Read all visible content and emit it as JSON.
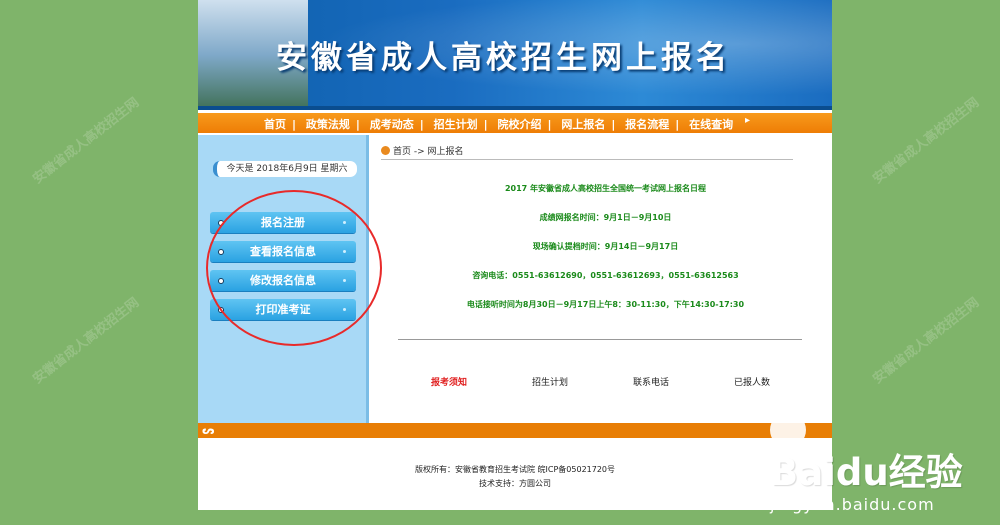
{
  "banner": {
    "title": "安徽省成人高校招生网上报名"
  },
  "nav": {
    "items": [
      "首页",
      "政策法规",
      "成考动态",
      "招生计划",
      "院校介绍",
      "网上报名",
      "报名流程",
      "在线查询"
    ],
    "end_mark": "▸"
  },
  "sidebar": {
    "date_label": "今天是 2018年6月9日 星期六",
    "buttons": [
      "报名注册",
      "查看报名信息",
      "修改报名信息",
      "打印准考证"
    ]
  },
  "breadcrumb": {
    "home": "首页",
    "arrow": " -> ",
    "current": "网上报名"
  },
  "notice": {
    "title": "2017 年安徽省成人高校招生全国统一考试网上报名日程",
    "lines": [
      "成绩网报名时间：9月1日－9月10日",
      "现场确认提档时间：9月14日－9月17日",
      "咨询电话：0551-63612690，0551-63612693，0551-63612563",
      "电话接听时间为8月30日－9月17日上午8：30-11:30，下午14:30-17:30"
    ]
  },
  "links": [
    "报考须知",
    "招生计划",
    "联系电话",
    "已报人数"
  ],
  "colors": {
    "highlight_link": "#e02020",
    "accent_orange": "#ee7d05",
    "notice_green": "#1a8a1a"
  },
  "footer": {
    "line1": "版权所有：安徽省教育招生考试院 皖ICP备05021720号",
    "line2": "技术支持：方圆公司"
  },
  "watermark": {
    "brand": "Baidu",
    "brand2": "经验",
    "url": "jingyan.baidu.com"
  }
}
